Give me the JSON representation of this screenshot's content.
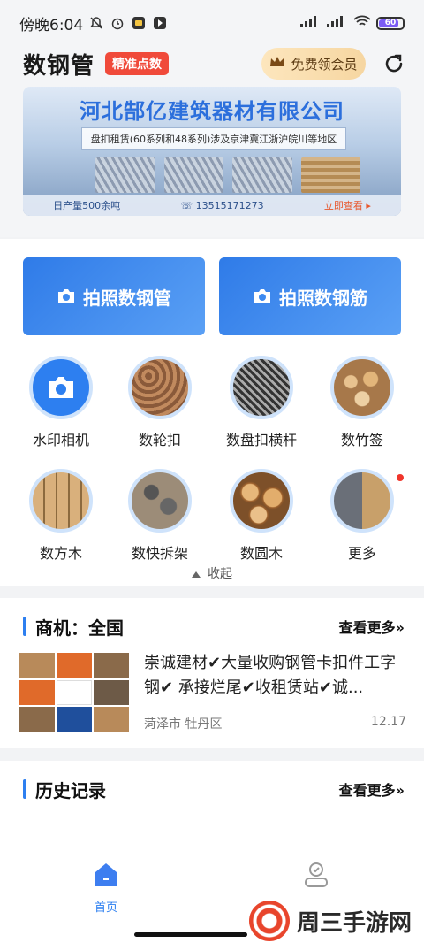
{
  "status_bar": {
    "time": "傍晚6:04",
    "battery": "60"
  },
  "header": {
    "title": "数钢管",
    "badge": "精准点数",
    "vip_label": "免费领会员"
  },
  "banner": {
    "company": "河北郜亿建筑器材有限公司",
    "subtitle": "盘扣租赁(60系列和48系列)涉及京津冀江浙沪皖川等地区",
    "output": "日产量500余吨",
    "phone": "13515171273",
    "cta": "立即查看 ▸"
  },
  "photo_buttons": {
    "pipe": "拍照数钢管",
    "rebar": "拍照数钢筋"
  },
  "grid": [
    {
      "label": "水印相机",
      "icon": "camera-icon"
    },
    {
      "label": "数轮扣",
      "icon": "wheel-buckle-icon"
    },
    {
      "label": "数盘扣横杆",
      "icon": "crossbar-icon"
    },
    {
      "label": "数竹签",
      "icon": "bamboo-stick-icon"
    },
    {
      "label": "数方木",
      "icon": "square-timber-icon"
    },
    {
      "label": "数快拆架",
      "icon": "quick-frame-icon"
    },
    {
      "label": "数圆木",
      "icon": "round-log-icon"
    },
    {
      "label": "更多",
      "icon": "more-icon"
    }
  ],
  "collapse_label": "收起",
  "business": {
    "title": "商机：全国",
    "more": "查看更多»",
    "item": {
      "text": "崇诚建材✔大量收购钢管卡扣件工字钢✔ 承接烂尾✔收租赁站✔诚...",
      "location": "菏泽市 牡丹区",
      "date": "12.17"
    }
  },
  "history": {
    "title": "历史记录",
    "more": "查看更多»"
  },
  "nav": {
    "home": "首页"
  },
  "watermark": "周三手游网",
  "colors": {
    "primary": "#2d7ff0",
    "badge": "#f04a3a",
    "vip_gold": "#f6d6a1"
  }
}
